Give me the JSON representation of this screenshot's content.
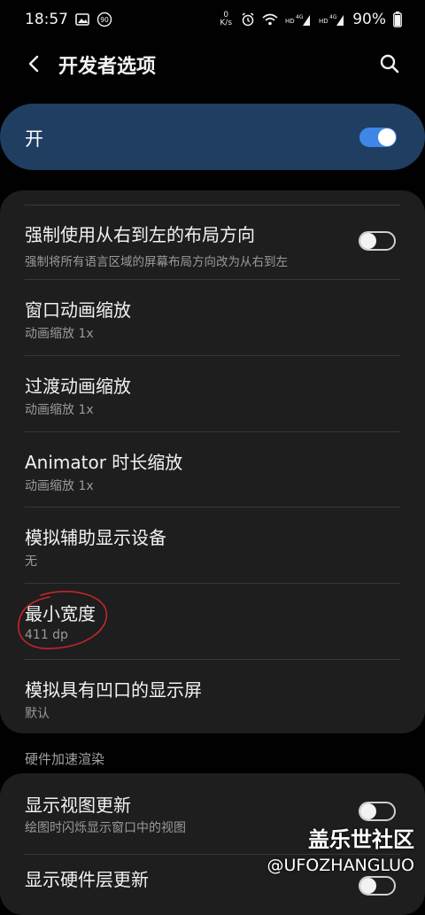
{
  "status_bar": {
    "time": "18:57",
    "left_icons": [
      "image-icon",
      "badge-90-icon"
    ],
    "net_speed": "0 K/s",
    "right_icons": [
      "alarm-icon",
      "wifi-icon",
      "hd-4g-signal-icon",
      "hd-4g-signal-icon"
    ],
    "battery": "90%"
  },
  "app_bar": {
    "title": "开发者选项",
    "back_icon": "chevron-left-icon",
    "search_icon": "search-icon"
  },
  "master_switch": {
    "label": "开",
    "state": true,
    "accent": "#3e87e6",
    "bg": "#1f3e62"
  },
  "settings": [
    {
      "title": "强制使用从右到左的布局方向",
      "subtitle": "强制将所有语言区域的屏幕布局方向改为从右到左",
      "toggle": false
    },
    {
      "title": "窗口动画缩放",
      "subtitle": "动画缩放 1x"
    },
    {
      "title": "过渡动画缩放",
      "subtitle": "动画缩放 1x"
    },
    {
      "title": "Animator 时长缩放",
      "subtitle": "动画缩放 1x"
    },
    {
      "title": "模拟辅助显示设备",
      "subtitle": "无"
    },
    {
      "title": "最小宽度",
      "subtitle": "411 dp",
      "annotated": true
    },
    {
      "title": "模拟具有凹口的显示屏",
      "subtitle": "默认"
    }
  ],
  "section_header": "硬件加速渲染",
  "hardware_settings": [
    {
      "title": "显示视图更新",
      "subtitle": "绘图时闪烁显示窗口中的视图",
      "toggle": false
    },
    {
      "title": "显示硬件层更新",
      "subtitle": "",
      "toggle": false
    }
  ],
  "watermark": {
    "line1": "盖乐世社区",
    "line2": "@UFOZHANGLUO"
  },
  "colors": {
    "background": "#010101",
    "card": "#1e1e1e",
    "annotation": "#c8242e"
  }
}
